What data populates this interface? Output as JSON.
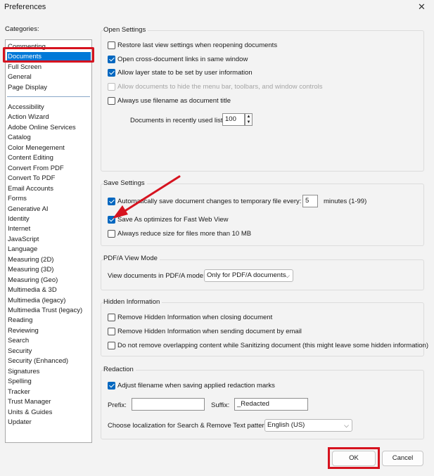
{
  "window": {
    "title": "Preferences",
    "close_glyph": "✕"
  },
  "categories": {
    "label": "Categories:",
    "top_items": [
      "Commenting",
      "Documents",
      "Full Screen",
      "General",
      "Page Display"
    ],
    "items": [
      "Accessibility",
      "Action Wizard",
      "Adobe Online Services",
      "Catalog",
      "Color Menegement",
      "Content Editing",
      "Convert From PDF",
      "Convert To PDF",
      "Email Accounts",
      "Forms",
      "Generative AI",
      "Identity",
      "Internet",
      "JavaScript",
      "Language",
      "Measuring (2D)",
      "Measuring (3D)",
      "Measuring (Geo)",
      "Multimedia & 3D",
      "Multimedia (legacy)",
      "Multimedia Trust (legacy)",
      "Reading",
      "Reviewing",
      "Search",
      "Security",
      "Security (Enhanced)",
      "Signatures",
      "Spelling",
      "Tracker",
      "Trust Manager",
      "Units & Guides",
      "Updater"
    ],
    "selected": "Documents"
  },
  "open_settings": {
    "title": "Open Settings",
    "options": [
      {
        "label": "Restore last view settings when reopening documents",
        "checked": false,
        "disabled": false
      },
      {
        "label": "Open cross-document links in same window",
        "checked": true,
        "disabled": false
      },
      {
        "label": "Allow layer state to be set by user information",
        "checked": true,
        "disabled": false
      },
      {
        "label": "Allow documents to hide the menu bar, toolbars, and window controls",
        "checked": false,
        "disabled": true
      },
      {
        "label": "Always use filename as document title",
        "checked": false,
        "disabled": false
      }
    ],
    "recent_label": "Documents in recently used list:",
    "recent_value": "100"
  },
  "save_settings": {
    "title": "Save Settings",
    "autosave_label": "Automatically save document changes to temporary file every:",
    "autosave_checked": true,
    "autosave_minutes": "5",
    "minutes_label": "minutes (1-99)",
    "fast_web_label": "Save As optimizes for Fast Web View",
    "fast_web_checked": true,
    "reduce_label": "Always reduce size for files more than 10 MB",
    "reduce_checked": false
  },
  "pdfa": {
    "title": "PDF/A View Mode",
    "label": "View documents in PDF/A mode:",
    "value": "Only for PDF/A documents"
  },
  "hidden_info": {
    "title": "Hidden Information",
    "options": [
      {
        "label": "Remove Hidden Information when closing document",
        "checked": false
      },
      {
        "label": "Remove Hidden Information when sending document by email",
        "checked": false
      },
      {
        "label": "Do not remove overlapping content while Sanitizing document (this might leave some hidden information)",
        "checked": false
      }
    ]
  },
  "redaction": {
    "title": "Redaction",
    "adjust_label": "Adjust filename when saving applied redaction marks",
    "adjust_checked": true,
    "prefix_label": "Prefix:",
    "prefix_value": "",
    "suffix_label": "Suffix:",
    "suffix_value": "_Redacted",
    "locale_label": "Choose localization for Search & Remove Text patterns:",
    "locale_value": "English (US)"
  },
  "buttons": {
    "ok": "OK",
    "cancel": "Cancel"
  },
  "annotation_color": "#d6131f",
  "accent_color": "#0067c0"
}
